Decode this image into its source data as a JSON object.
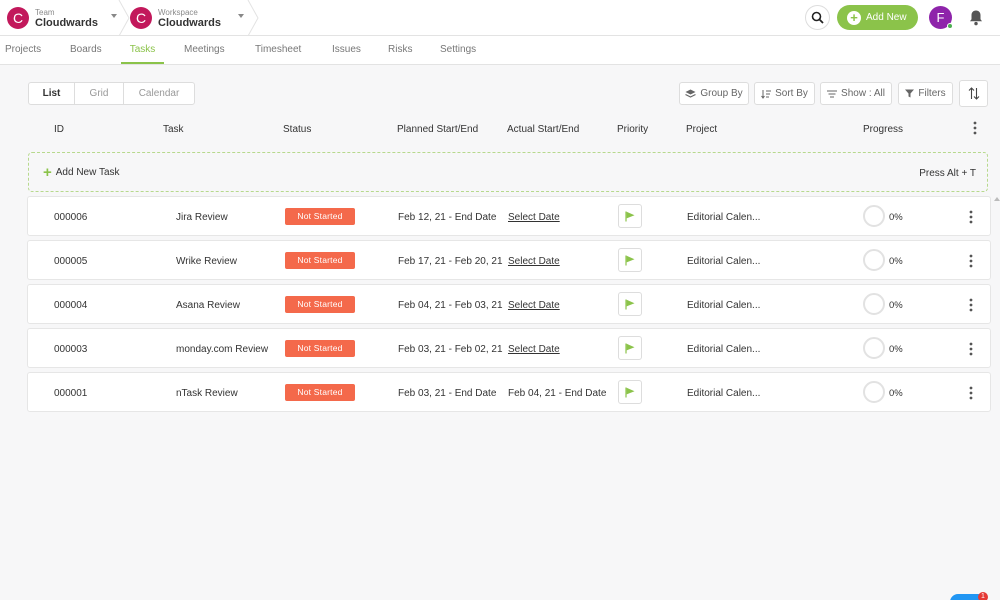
{
  "header": {
    "team": {
      "small": "Team",
      "name": "Cloudwards",
      "initial": "C"
    },
    "workspace": {
      "small": "Workspace",
      "name": "Cloudwards",
      "initial": "C"
    },
    "add_new_label": "Add New",
    "user_initial": "F",
    "accent_color": "#8bc34a"
  },
  "nav": {
    "tabs": [
      {
        "label": "Projects"
      },
      {
        "label": "Boards"
      },
      {
        "label": "Tasks",
        "active": true
      },
      {
        "label": "Meetings"
      },
      {
        "label": "Timesheet"
      },
      {
        "label": "Issues"
      },
      {
        "label": "Risks"
      },
      {
        "label": "Settings"
      }
    ]
  },
  "views": {
    "items": [
      {
        "label": "List",
        "active": true
      },
      {
        "label": "Grid"
      },
      {
        "label": "Calendar"
      }
    ]
  },
  "toolbar": {
    "group_by": "Group By",
    "sort_by": "Sort By",
    "show": "Show : All",
    "filters": "Filters"
  },
  "table": {
    "columns": {
      "id": "ID",
      "task": "Task",
      "status": "Status",
      "planned": "Planned Start/End",
      "actual": "Actual Start/End",
      "priority": "Priority",
      "project": "Project",
      "progress": "Progress"
    },
    "add_task_label": "Add New Task",
    "add_task_hint": "Press Alt + T",
    "rows": [
      {
        "id": "000006",
        "task": "Jira Review",
        "status": "Not Started",
        "planned": "Feb 12, 21 - End Date",
        "actual": "Select Date",
        "project": "Editorial Calen...",
        "progress": "0%"
      },
      {
        "id": "000005",
        "task": "Wrike Review",
        "status": "Not Started",
        "planned": "Feb 17, 21 - Feb 20, 21",
        "actual": "Select Date",
        "project": "Editorial Calen...",
        "progress": "0%"
      },
      {
        "id": "000004",
        "task": "Asana Review",
        "status": "Not Started",
        "planned": "Feb 04, 21 - Feb 03, 21",
        "actual": "Select Date",
        "project": "Editorial Calen...",
        "progress": "0%"
      },
      {
        "id": "000003",
        "task": "monday.com Review",
        "status": "Not Started",
        "planned": "Feb 03, 21 - Feb 02, 21",
        "actual": "Select Date",
        "project": "Editorial Calen...",
        "progress": "0%"
      },
      {
        "id": "000001",
        "task": "nTask Review",
        "status": "Not Started",
        "planned": "Feb 03, 21 - End Date",
        "actual": "Feb 04, 21 - End Date",
        "project": "Editorial Calen...",
        "progress": "0%"
      }
    ]
  },
  "chat_badge": "1"
}
